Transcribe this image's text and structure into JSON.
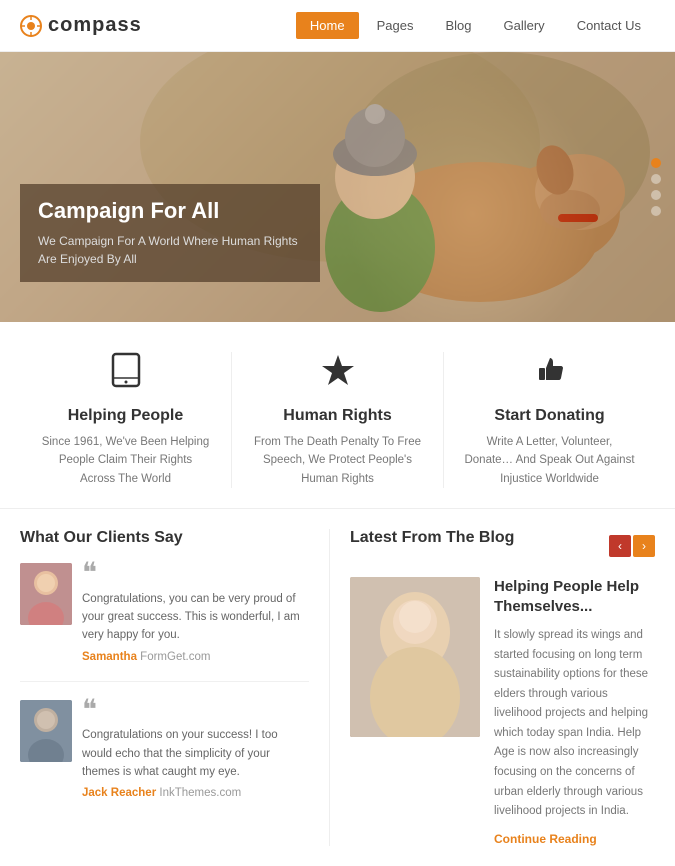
{
  "header": {
    "logo_icon": "◎",
    "logo_text": "compass",
    "nav": {
      "items": [
        {
          "label": "Home",
          "active": true
        },
        {
          "label": "Pages",
          "active": false
        },
        {
          "label": "Blog",
          "active": false
        },
        {
          "label": "Gallery",
          "active": false
        },
        {
          "label": "Contact Us",
          "active": false
        }
      ]
    }
  },
  "hero": {
    "title": "Campaign For All",
    "subtitle": "We Campaign For A World Where Human Rights Are Enjoyed By All",
    "dots": 4,
    "active_dot": 0
  },
  "features": [
    {
      "icon": "📱",
      "icon_unicode": "▭",
      "title": "Helping People",
      "description": "Since 1961, We've Been Helping People Claim Their Rights Across The World"
    },
    {
      "icon": "★",
      "title": "Human Rights",
      "description": "From The Death Penalty To Free Speech, We Protect People's Human Rights"
    },
    {
      "icon": "👍",
      "icon_unicode": "thumbs-up",
      "title": "Start Donating",
      "description": "Write A Letter, Volunteer, Donate… And Speak Out Against Injustice Worldwide"
    }
  ],
  "testimonials": {
    "section_title": "What Our Clients Say",
    "items": [
      {
        "text": "Congratulations, you can be very proud of your great success. This is wonderful, I am very happy for you.",
        "author_name": "Samantha",
        "author_site": "FormGet.com",
        "gender": "female"
      },
      {
        "text": "Congratulations on your success! I too would echo that the simplicity of your themes is what caught my eye.",
        "author_name": "Jack Reacher",
        "author_site": "InkThemes.com",
        "gender": "male"
      }
    ]
  },
  "blog": {
    "section_title": "Latest From The Blog",
    "post": {
      "title": "Helping People Help Themselves...",
      "text": "It slowly spread its wings and started focusing on long term sustainability options for these elders through various livelihood projects and helping which today span India. Help Age is now also increasingly focusing on the concerns of urban elderly through various livelihood projects in India.",
      "read_more": "Continue Reading"
    }
  }
}
